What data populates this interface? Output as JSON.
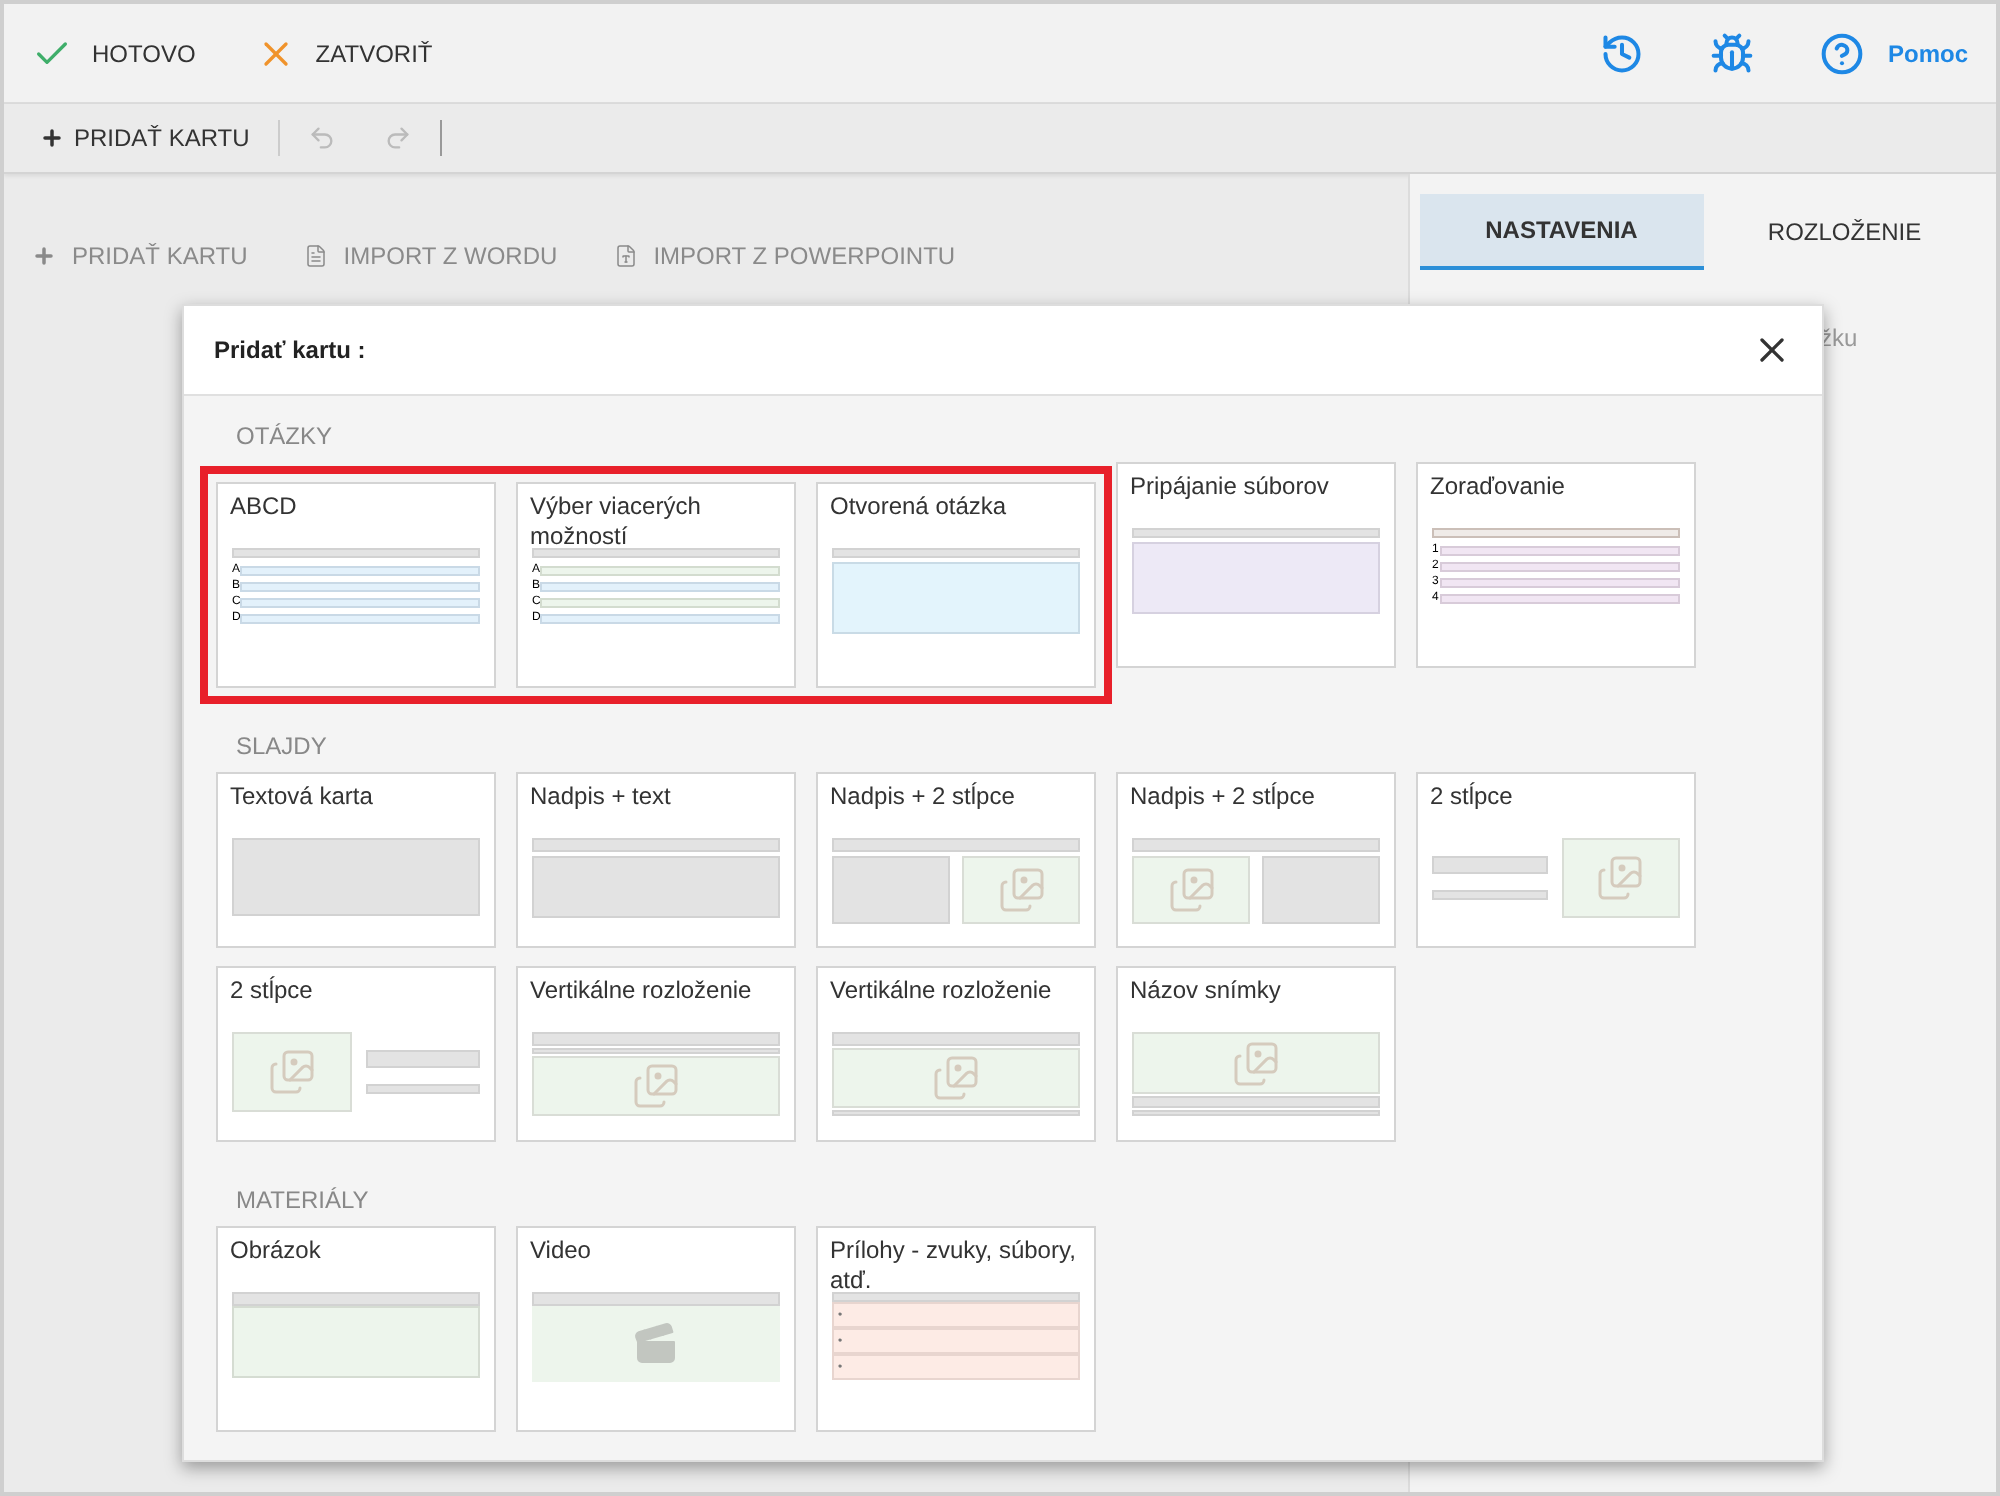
{
  "top_bar": {
    "actions": [
      {
        "kind": "done",
        "label": "HOTOVO"
      },
      {
        "kind": "close",
        "label": "ZATVORIŤ"
      }
    ],
    "icons": [
      {
        "kind": "history"
      },
      {
        "kind": "bug"
      },
      {
        "kind": "help"
      }
    ],
    "help_label": "Pomoc"
  },
  "toolbar": {
    "add_label": "PRIDAŤ KARTU",
    "undo_disabled": true,
    "redo_disabled": true
  },
  "content_actions": [
    {
      "kind": "add",
      "label": "PRIDAŤ KARTU"
    },
    {
      "kind": "word",
      "label": "IMPORT Z WORDU"
    },
    {
      "kind": "powerpoint",
      "label": "IMPORT Z POWERPOINTU"
    }
  ],
  "side_panel": {
    "tabs": [
      {
        "label": "NASTAVENIA",
        "selected": true
      },
      {
        "label": "ROZLOŽENIE",
        "selected": false
      }
    ],
    "partial_text": "žku"
  },
  "dialog": {
    "title": "Pridať kartu :",
    "sections": [
      {
        "kind": "questions",
        "label": "OTÁZKY",
        "cards": [
          {
            "title": "ABCD",
            "kind": "abcd",
            "highlighted": true,
            "markers": [
              "A",
              "B",
              "C",
              "D"
            ]
          },
          {
            "title": "Výber viacerých možností",
            "kind": "multi",
            "highlighted": true,
            "markers": [
              "A",
              "B",
              "C",
              "D"
            ]
          },
          {
            "title": "Otvorená otázka",
            "kind": "open",
            "highlighted": true
          },
          {
            "title": "Pripájanie súborov",
            "kind": "attach",
            "highlighted": false
          },
          {
            "title": "Zoraďovanie",
            "kind": "order",
            "highlighted": false,
            "markers": [
              "1",
              "2",
              "3",
              "4"
            ]
          }
        ]
      },
      {
        "kind": "slides",
        "label": "SLAJDY",
        "cards": [
          {
            "title": "Textová karta",
            "kind": "text"
          },
          {
            "title": "Nadpis + text",
            "kind": "title_text"
          },
          {
            "title": "Nadpis + 2 stĺpce",
            "kind": "title_text_image"
          },
          {
            "title": "Nadpis + 2 stĺpce",
            "kind": "title_image_text"
          },
          {
            "title": "2 stĺpce",
            "kind": "text_image"
          },
          {
            "title": "2 stĺpce",
            "kind": "image_text"
          },
          {
            "title": "Vertikálne rozloženie",
            "kind": "vertical_top"
          },
          {
            "title": "Vertikálne rozloženie",
            "kind": "vertical_bottom"
          },
          {
            "title": "Názov snímky",
            "kind": "slide_title"
          }
        ]
      },
      {
        "kind": "materials",
        "label": "MATERIÁLY",
        "cards": [
          {
            "title": "Obrázok",
            "kind": "image"
          },
          {
            "title": "Video",
            "kind": "video"
          },
          {
            "title": "Prílohy - zvuky, súbory, atď.",
            "kind": "attachments",
            "markers": [
              "•",
              "•",
              "•"
            ]
          }
        ]
      }
    ]
  }
}
